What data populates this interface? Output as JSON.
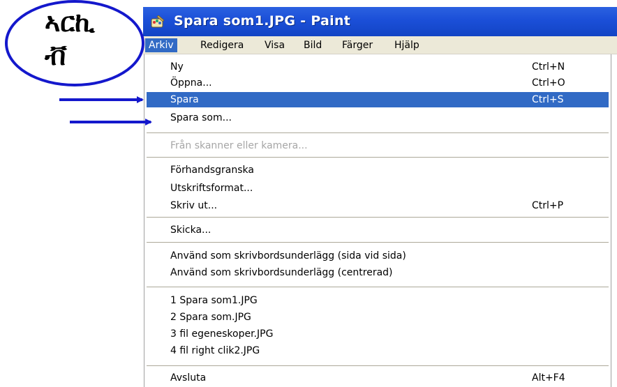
{
  "window": {
    "title": "Spara som1.JPG - Paint",
    "icon": "paint-icon"
  },
  "menubar": {
    "items": [
      {
        "label": "Arkiv",
        "active": true
      },
      {
        "label": "Redigera"
      },
      {
        "label": "Visa"
      },
      {
        "label": "Bild"
      },
      {
        "label": "Färger"
      },
      {
        "label": "Hjälp"
      }
    ]
  },
  "file_menu": {
    "items": [
      {
        "label": "Ny",
        "shortcut": "Ctrl+N"
      },
      {
        "label": "Öppna...",
        "shortcut": "Ctrl+O"
      },
      {
        "label": "Spara",
        "shortcut": "Ctrl+S",
        "highlighted": true
      },
      {
        "label": "Spara som..."
      },
      {
        "label": "Från skanner eller kamera...",
        "disabled": true
      },
      {
        "label": "Förhandsgranska"
      },
      {
        "label": "Utskriftsformat..."
      },
      {
        "label": "Skriv ut...",
        "shortcut": "Ctrl+P"
      },
      {
        "label": "Skicka..."
      },
      {
        "label": "Använd som skrivbordsunderlägg (sida vid sida)"
      },
      {
        "label": "Använd som skrivbordsunderlägg (centrerad)"
      },
      {
        "label": "1 Spara som1.JPG"
      },
      {
        "label": "2 Spara som.JPG"
      },
      {
        "label": "3 fil egeneskoper.JPG"
      },
      {
        "label": "4 fil right clik2.JPG"
      },
      {
        "label": "Avsluta",
        "shortcut": "Alt+F4"
      }
    ]
  },
  "annotation": {
    "text": "ኣርኪ\nቭ",
    "color": "#1418cc"
  },
  "colors": {
    "titlebar": "#1b4fd8",
    "highlight": "#316ac5",
    "menubar_bg": "#ece9d8",
    "disabled_text": "#a6a6a6",
    "annotation_blue": "#1418cc"
  }
}
